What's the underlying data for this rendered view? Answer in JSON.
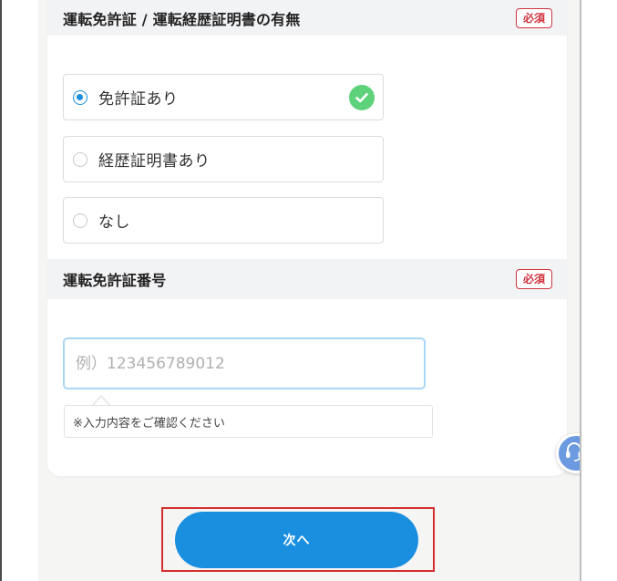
{
  "license_section": {
    "title": "運転免許証 / 運転経歴証明書の有無",
    "required_label": "必須",
    "options": [
      {
        "label": "免許証あり",
        "selected": true
      },
      {
        "label": "経歴証明書あり",
        "selected": false
      },
      {
        "label": "なし",
        "selected": false
      }
    ]
  },
  "license_number_section": {
    "title": "運転免許証番号",
    "required_label": "必須",
    "input": {
      "value": "",
      "placeholder": "例）123456789012"
    },
    "hint": "※入力内容をご確認ください"
  },
  "next_button": {
    "label": "次へ"
  },
  "colors": {
    "accent": "#1a8fe0",
    "required": "#d0343f",
    "valid": "#5ed27a",
    "highlight": "#d32f2f"
  },
  "icons": {
    "valid": "check-circle-icon",
    "support": "headset-icon"
  }
}
